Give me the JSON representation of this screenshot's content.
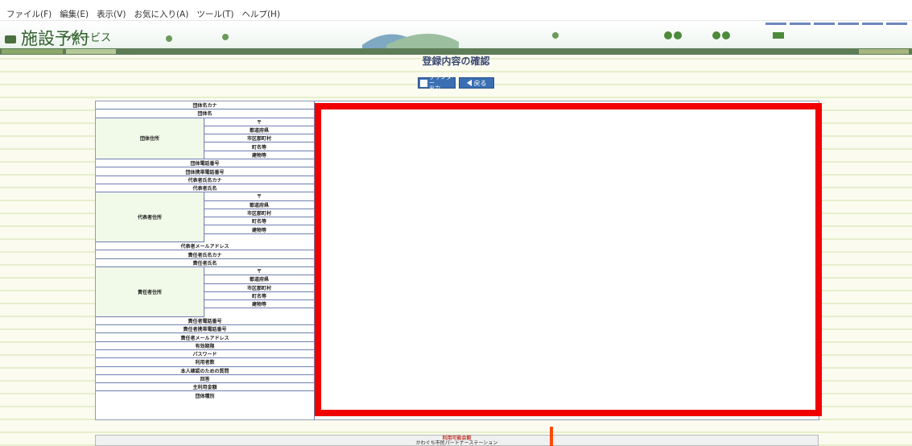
{
  "menu": [
    "ファイル(F)",
    "編集(E)",
    "表示(V)",
    "お気に入り(A)",
    "ツール(T)",
    "ヘルプ(H)"
  ],
  "banner": {
    "logo_main": "施設予約",
    "logo_sub": "サービス"
  },
  "page": {
    "title": "登録内容の確認"
  },
  "buttons": {
    "print": "プリンター\n出力",
    "back": "戻る"
  },
  "form": {
    "fields_top": [
      "団体名カナ",
      "団体名"
    ],
    "org_address": {
      "group": "団体住所",
      "parts": [
        "〒",
        "都道府県",
        "市区郡町村",
        "町名等",
        "建物等"
      ]
    },
    "fields_mid1": [
      "団体電話番号",
      "団体携帯電話番号",
      "代表者氏名カナ",
      "代表者氏名"
    ],
    "rep_address": {
      "group": "代表者住所",
      "parts": [
        "〒",
        "都道府県",
        "市区郡町村",
        "町名等",
        "建物等"
      ]
    },
    "fields_mid2": [
      "代表者メールアドレス",
      "責任者氏名カナ",
      "責任者氏名"
    ],
    "resp_address": {
      "group": "責任者住所",
      "parts": [
        "〒",
        "都道府県",
        "市区郡町村",
        "町名等",
        "建物等"
      ]
    },
    "fields_bottom": [
      "責任者電話番号",
      "責任者携帯電話番号",
      "責任者メールアドレス",
      "有効期限",
      "パスワード",
      "利用者数",
      "本人確認のための質問",
      "回答",
      "主利用金額",
      "団体種別"
    ]
  },
  "footer": {
    "line1": "利用可能会館",
    "line2": "かわぐち市民パートナーステーション"
  },
  "colors": {
    "highlight": "#f00000",
    "accent": "#3b6fb3",
    "title": "#3e4a74"
  }
}
